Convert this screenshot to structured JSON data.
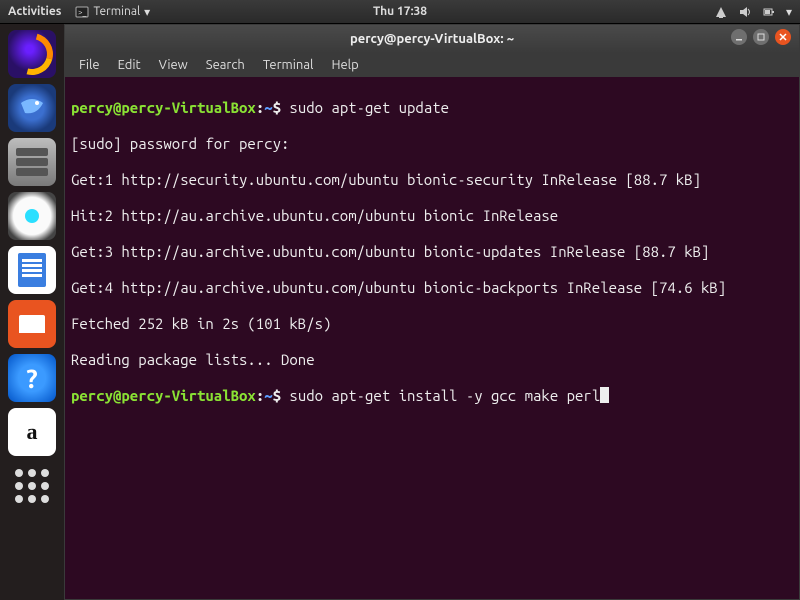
{
  "top": {
    "activities": "Activities",
    "app_label": "Terminal",
    "clock": "Thu 17:38"
  },
  "dock": {
    "help_glyph": "?",
    "amazon_glyph": "a"
  },
  "window": {
    "title": "percy@percy-VirtualBox: ~",
    "menus": [
      "File",
      "Edit",
      "View",
      "Search",
      "Terminal",
      "Help"
    ]
  },
  "prompt": {
    "userhost": "percy@percy-VirtualBox",
    "sep": ":",
    "path": "~",
    "dollar": "$"
  },
  "terminal": {
    "cmd1": " sudo apt-get update",
    "lines": [
      "[sudo] password for percy:",
      "Get:1 http://security.ubuntu.com/ubuntu bionic-security InRelease [88.7 kB]",
      "Hit:2 http://au.archive.ubuntu.com/ubuntu bionic InRelease",
      "Get:3 http://au.archive.ubuntu.com/ubuntu bionic-updates InRelease [88.7 kB]",
      "Get:4 http://au.archive.ubuntu.com/ubuntu bionic-backports InRelease [74.6 kB]",
      "Fetched 252 kB in 2s (101 kB/s)",
      "Reading package lists... Done"
    ],
    "cmd2": " sudo apt-get install -y gcc make perl"
  }
}
